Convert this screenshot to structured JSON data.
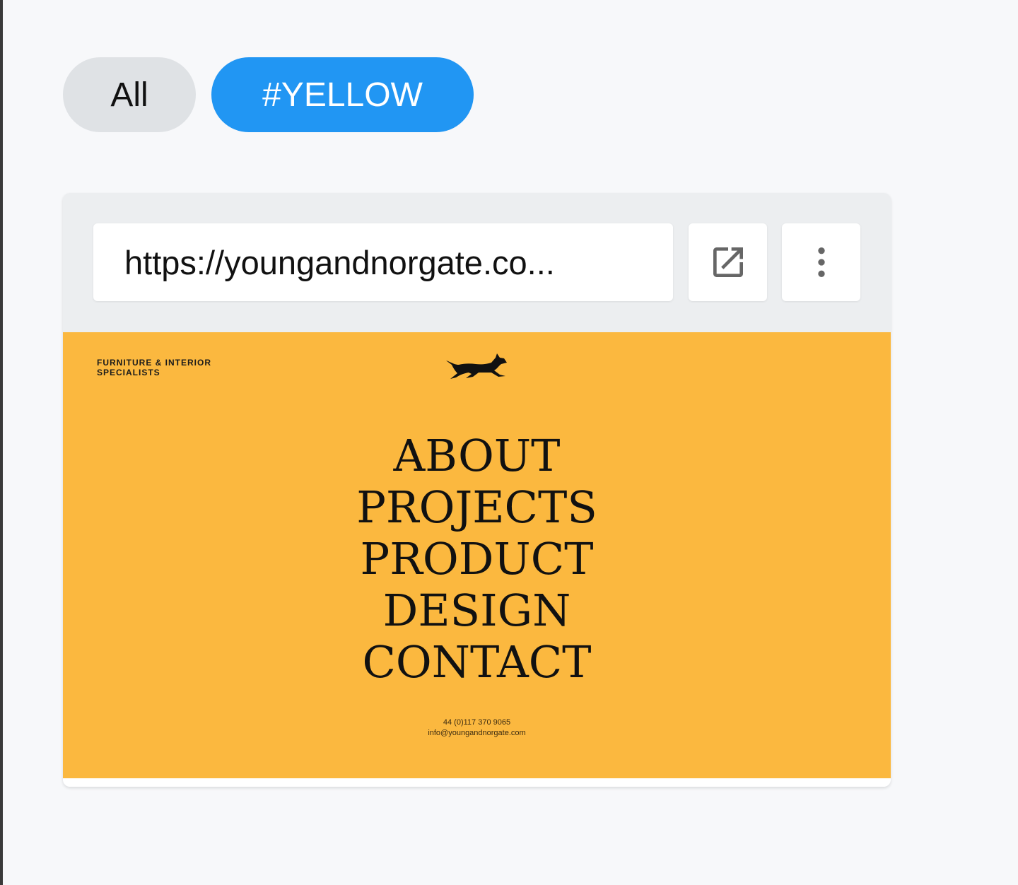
{
  "filters": {
    "all_label": "All",
    "tag_label": "#YELLOW"
  },
  "colors": {
    "active_chip": "#2196f3",
    "inactive_chip": "#dfe2e5",
    "preview_background": "#fbb83f"
  },
  "card": {
    "url": "https://youngandnorgate.co...",
    "open_icon": "open-in-new-icon",
    "more_icon": "more-vertical-icon"
  },
  "preview": {
    "tagline": "FURNITURE & INTERIOR\nSPECIALISTS",
    "logo_icon": "fox-logo-icon",
    "menu": [
      "ABOUT",
      "PROJECTS",
      "PRODUCT",
      "DESIGN",
      "CONTACT"
    ],
    "phone": "44 (0)117 370 9065",
    "email": "info@youngandnorgate.com"
  }
}
